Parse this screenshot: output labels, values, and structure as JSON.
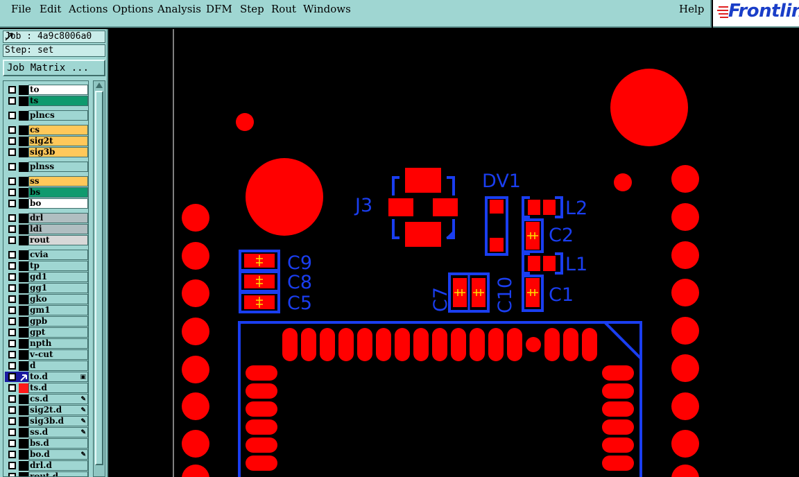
{
  "menubar": {
    "items": [
      {
        "label": "File"
      },
      {
        "label": "Edit"
      },
      {
        "label": "Actions"
      },
      {
        "label": "Options"
      },
      {
        "label": "Analysis"
      },
      {
        "label": "DFM"
      },
      {
        "label": "Step"
      },
      {
        "label": "Rout"
      },
      {
        "label": "Windows"
      }
    ],
    "help": "Help"
  },
  "brand": {
    "name": "Frontline"
  },
  "panel": {
    "job": "Job : 4a9c8006a0",
    "step": "Step: set",
    "job_matrix_button": "Job Matrix ..."
  },
  "layers": [
    {
      "name": "to",
      "color": "#ffffff"
    },
    {
      "name": "ts",
      "color": "#0f9a6e"
    },
    {
      "name": "plncs",
      "color": "#9fd6d2"
    },
    {
      "name": "cs",
      "color": "#ffc85a"
    },
    {
      "name": "sig2t",
      "color": "#ffc85a"
    },
    {
      "name": "sig3b",
      "color": "#ffc85a"
    },
    {
      "name": "plnss",
      "color": "#9fd6d2"
    },
    {
      "name": "ss",
      "color": "#ffc85a"
    },
    {
      "name": "bs",
      "color": "#0f9a6e"
    },
    {
      "name": "bo",
      "color": "#ffffff"
    },
    {
      "name": "drl",
      "color": "#b0bec1"
    },
    {
      "name": "ldi",
      "color": "#b0bec1"
    },
    {
      "name": "rout",
      "color": "#d8d8d8"
    },
    {
      "name": "cvia",
      "color": "#9fd6d2"
    },
    {
      "name": "tp",
      "color": "#9fd6d2"
    },
    {
      "name": "gd1",
      "color": "#9fd6d2"
    },
    {
      "name": "gg1",
      "color": "#9fd6d2"
    },
    {
      "name": "gko",
      "color": "#9fd6d2"
    },
    {
      "name": "gm1",
      "color": "#9fd6d2"
    },
    {
      "name": "gpb",
      "color": "#9fd6d2"
    },
    {
      "name": "gpt",
      "color": "#9fd6d2"
    },
    {
      "name": "npth",
      "color": "#9fd6d2"
    },
    {
      "name": "v-cut",
      "color": "#9fd6d2"
    },
    {
      "name": "d",
      "color": "#9fd6d2"
    },
    {
      "name": "to.d",
      "color": "#9fd6d2"
    },
    {
      "name": "ts.d",
      "color": "#9fd6d2"
    },
    {
      "name": "cs.d",
      "color": "#9fd6d2"
    },
    {
      "name": "sig2t.d",
      "color": "#9fd6d2"
    },
    {
      "name": "sig3b.d",
      "color": "#9fd6d2"
    },
    {
      "name": "ss.d",
      "color": "#9fd6d2"
    },
    {
      "name": "bs.d",
      "color": "#9fd6d2"
    },
    {
      "name": "bo.d",
      "color": "#9fd6d2"
    },
    {
      "name": "drl.d",
      "color": "#9fd6d2"
    },
    {
      "name": "rout.d",
      "color": "#9fd6d2"
    }
  ],
  "board": {
    "pad_color": "#ff0000",
    "outline_color": "#1a3ef0",
    "refdes": [
      "DV1",
      "J3",
      "L2",
      "C2",
      "L1",
      "C1",
      "C9",
      "C8",
      "C5",
      "C7",
      "C10"
    ]
  }
}
